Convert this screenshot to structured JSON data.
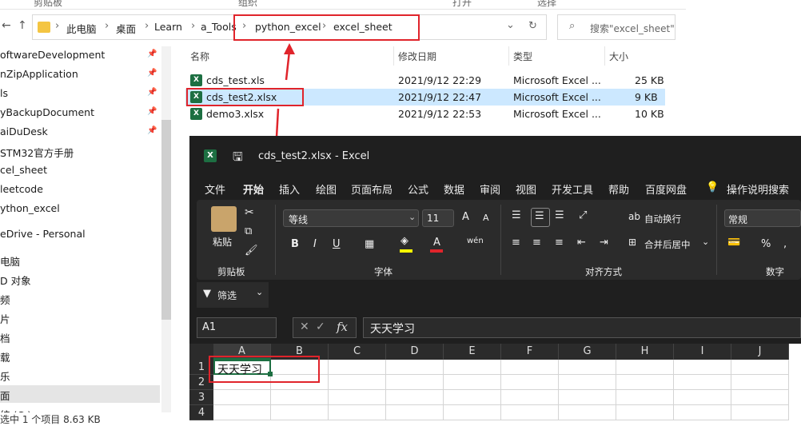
{
  "explorer": {
    "ribbon_top": {
      "clipboard": "剪贴板",
      "organize": "组织",
      "open": "打开",
      "select": "选择"
    },
    "breadcrumb": [
      "此电脑",
      "桌面",
      "Learn",
      "a_Tools",
      "python_excel",
      "excel_sheet"
    ],
    "search_placeholder": "搜索\"excel_sheet\"",
    "sidebar": [
      {
        "label": "oftwareDevelopment",
        "pinned": true
      },
      {
        "label": "nZipApplication",
        "pinned": true
      },
      {
        "label": "ls",
        "pinned": true
      },
      {
        "label": "yBackupDocument",
        "pinned": true
      },
      {
        "label": "aiDuDesk",
        "pinned": true
      },
      {
        "label": "STM32官方手册",
        "pinned": false
      },
      {
        "label": "cel_sheet",
        "pinned": false
      },
      {
        "label": "leetcode",
        "pinned": false
      },
      {
        "label": "ython_excel",
        "pinned": false
      },
      {
        "label": "eDrive - Personal",
        "pinned": false
      },
      {
        "label": "电脑",
        "pinned": false
      },
      {
        "label": "D 对象",
        "pinned": false
      },
      {
        "label": "频",
        "pinned": false
      },
      {
        "label": "片",
        "pinned": false
      },
      {
        "label": "档",
        "pinned": false
      },
      {
        "label": "载",
        "pinned": false
      },
      {
        "label": "乐",
        "pinned": false
      },
      {
        "label": "面",
        "pinned": false
      },
      {
        "label": "统 (C:)",
        "pinned": false
      }
    ],
    "columns": {
      "name": "名称",
      "modified": "修改日期",
      "type": "类型",
      "size": "大小"
    },
    "files": [
      {
        "name": "cds_test.xls",
        "modified": "2021/9/12 22:29",
        "type": "Microsoft Excel ...",
        "size": "25 KB"
      },
      {
        "name": "cds_test2.xlsx",
        "modified": "2021/9/12 22:47",
        "type": "Microsoft Excel ...",
        "size": "9 KB"
      },
      {
        "name": "demo3.xlsx",
        "modified": "2021/9/12 22:53",
        "type": "Microsoft Excel ...",
        "size": "10 KB"
      }
    ],
    "status": "选中 1 个项目  8.63 KB"
  },
  "excel": {
    "title": "cds_test2.xlsx  -  Excel",
    "menu": [
      "文件",
      "开始",
      "插入",
      "绘图",
      "页面布局",
      "公式",
      "数据",
      "审阅",
      "视图",
      "开发工具",
      "帮助",
      "百度网盘",
      "操作说明搜索"
    ],
    "ribbon": {
      "paste": "粘贴",
      "clipboard_group": "剪贴板",
      "font_name": "等线",
      "font_size": "11",
      "font_group": "字体",
      "wrap": "自动换行",
      "merge": "合并后居中",
      "align_group": "对齐方式",
      "number_format": "常规",
      "number_group": "数字",
      "percent": "%"
    },
    "filter_label": "筛选",
    "name_box": "A1",
    "formula": "天天学习",
    "columns": [
      "A",
      "B",
      "C",
      "D",
      "E",
      "F",
      "G",
      "H",
      "I",
      "J"
    ],
    "rows": [
      "1",
      "2",
      "3",
      "4"
    ],
    "a1_value": "天天学习"
  },
  "colors": {
    "highlight": "#e0242b",
    "excel_green": "#1d6f42",
    "selection": "#cce8ff"
  }
}
